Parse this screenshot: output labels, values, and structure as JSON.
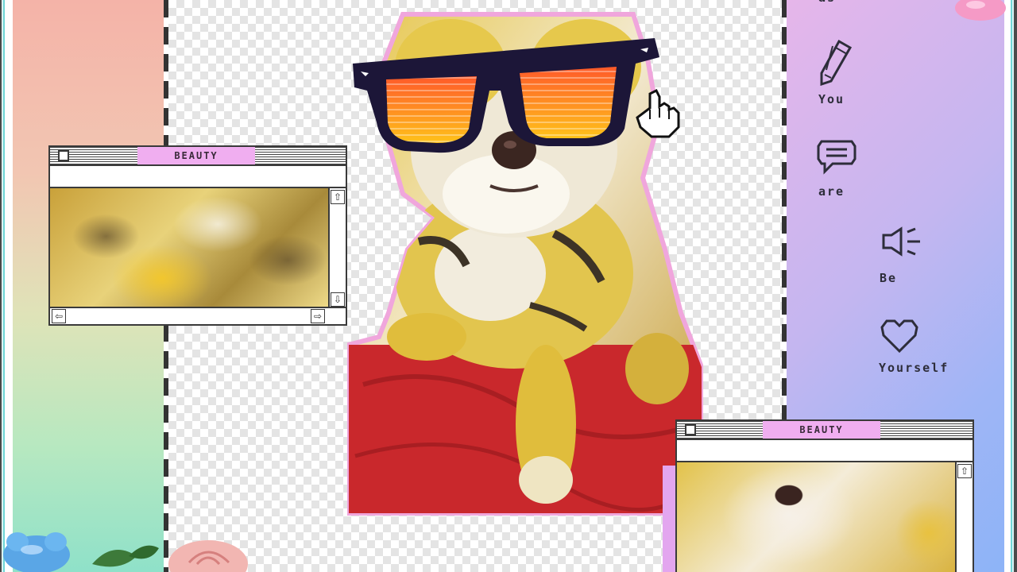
{
  "windows": [
    {
      "title": "BEAUTY"
    },
    {
      "title": "BEAUTY"
    }
  ],
  "side_words": {
    "as": "as",
    "you": "You",
    "are": "are",
    "be": "Be",
    "yourself": "Yourself"
  },
  "icons": {
    "pencil": "pencil-icon",
    "speech": "speech-bubble-icon",
    "speaker": "speaker-icon",
    "heart": "heart-icon",
    "cursor": "pointing-hand-cursor-icon"
  },
  "colors": {
    "title_tab": "#f0aef0",
    "left_gradient_top": "#f4b3a8",
    "left_gradient_bottom": "#8fe1c9",
    "right_gradient_start": "#e6b6ea",
    "right_gradient_end": "#8db4f7",
    "cutout_outline": "#f0a6dc",
    "blanket": "#c9282c"
  }
}
